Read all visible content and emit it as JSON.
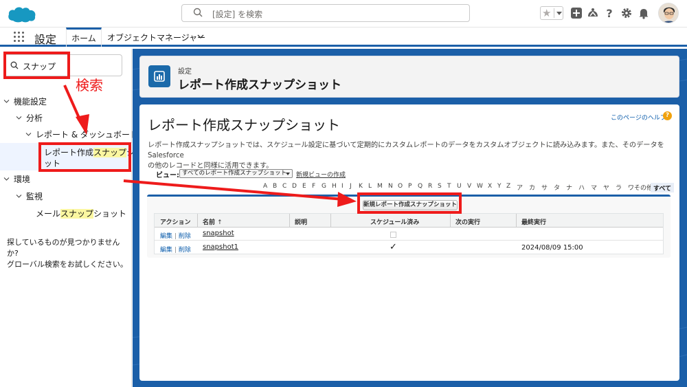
{
  "header": {
    "search_placeholder": "[設定] を検索",
    "icons": [
      "favorites-star-icon",
      "add-icon",
      "trailhead-icon",
      "help-icon",
      "setup-gear-icon",
      "notifications-bell-icon",
      "user-avatar"
    ]
  },
  "nav": {
    "app_name": "設定",
    "tabs": [
      {
        "label": "ホーム"
      },
      {
        "label": "オブジェクトマネージャー"
      }
    ]
  },
  "sidebar": {
    "quick_find": {
      "value": "スナップ"
    },
    "tree": [
      {
        "label": "機能設定"
      },
      {
        "label": "分析"
      },
      {
        "label": "レポート & ダッシュボード"
      },
      {
        "label_before": "レポート作成",
        "label_match": "スナップ",
        "label_after": "ショ",
        "label_line2": "ット"
      },
      {
        "label": "環境"
      },
      {
        "label": "監視"
      },
      {
        "label_before": "メール",
        "label_match": "スナップ",
        "label_after": "ショット"
      }
    ],
    "not_found": {
      "line1": "探しているものが見つかりませんか?",
      "line2": "グローバル検索をお試しください。"
    }
  },
  "page_header": {
    "breadcrumb": "設定",
    "title": "レポート作成スナップショット"
  },
  "content": {
    "title": "レポート作成スナップショット",
    "help_link": "このページのヘルプ",
    "help_icon": "?",
    "description_line1": "レポート作成スナップショットでは、スケジュール設定に基づいて定期的にカスタムレポートのデータをカスタムオブジェクトに読み込みます。また、そのデータを Salesforce",
    "description_line2": "の他のレコードと同様に活用できます。",
    "view_label": "ビュー:",
    "view_selected": "すべてのレポート作成スナップショット",
    "view_new_link": "新規ビューの作成",
    "alphabet": [
      "A",
      "B",
      "C",
      "D",
      "E",
      "F",
      "G",
      "H",
      "I",
      "J",
      "K",
      "L",
      "M",
      "N",
      "O",
      "P",
      "Q",
      "R",
      "S",
      "T",
      "U",
      "V",
      "W",
      "X",
      "Y",
      "Z",
      "ア",
      "カ",
      "サ",
      "タ",
      "ナ",
      "ハ",
      "マ",
      "ヤ",
      "ラ",
      "ワ",
      "その他"
    ],
    "alphabet_all": "すべて",
    "new_button": "新規レポート作成スナップショット",
    "table": {
      "headers": {
        "action": "アクション",
        "name": "名前",
        "sort_indicator": "↑",
        "description": "説明",
        "scheduled": "スケジュール済み",
        "next_run": "次の実行",
        "last_run": "最終実行"
      },
      "rows": [
        {
          "edit": "編集",
          "sep": "|",
          "delete": "削除",
          "name": "snapshot",
          "scheduled": false,
          "last_run": ""
        },
        {
          "edit": "編集",
          "sep": "|",
          "delete": "削除",
          "name": "snapshot1",
          "scheduled": true,
          "check": "✓",
          "last_run": "2024/08/09 15:00"
        }
      ]
    }
  },
  "annotation": {
    "label": "検索",
    "color": "#ee1b1b"
  }
}
